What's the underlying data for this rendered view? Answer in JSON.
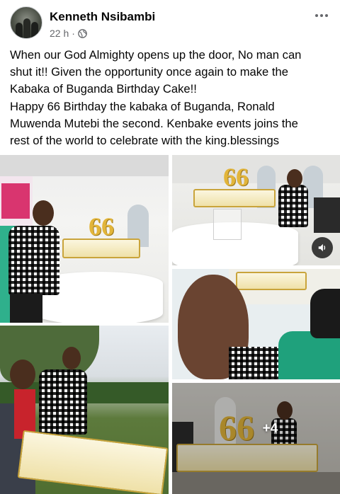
{
  "post": {
    "author": "Kenneth Nsibambi",
    "time": "22 h",
    "separator": "·",
    "privacy_icon": "globe-icon",
    "menu_icon": "more-horizontal-icon",
    "text_lines": [
      "When our God Almighty opens up the door, No man can",
      "shut it!! Given the opportunity once again to make the",
      "Kabaka of Buganda Birthday Cake!!",
      "Happy 66 Birthday the kabaka of Buganda, Ronald",
      "Muwenda Mutebi the second. Kenbake events joins the",
      "rest of the world to celebrate with the king.blessings"
    ]
  },
  "photos": {
    "cake_number": "66",
    "more_count": "+4",
    "video_icon": "volume-icon"
  },
  "colors": {
    "meta_gray": "#65676b",
    "cake_gold": "#e2b53a",
    "text": "#050505"
  }
}
